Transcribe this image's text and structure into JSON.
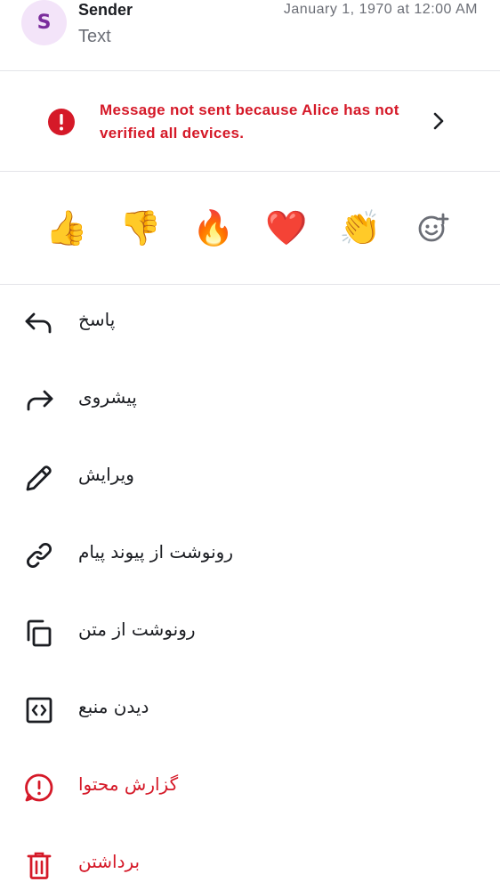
{
  "header": {
    "avatar_letter": "S",
    "sender_name": "Sender",
    "message_preview": "Text",
    "timestamp": "January 1, 1970 at 12:00 AM"
  },
  "banner": {
    "message": "Message not sent because Alice has not verified all devices.",
    "icon": "error-circle-icon",
    "chevron": "chevron-right-icon"
  },
  "reactions": {
    "items": [
      "👍",
      "👎",
      "🔥",
      "❤️",
      "👏"
    ],
    "add_icon": "add-reaction-icon"
  },
  "menu": {
    "reply": "پاسخ",
    "forward": "پیشروی",
    "edit": "ویرایش",
    "copy_link": "رونوشت از پیوند پیام",
    "copy_text": "رونوشت از متن",
    "view_source": "دیدن منبع",
    "report": "گزارش محتوا",
    "remove": "برداشتن"
  },
  "colors": {
    "danger": "#d51928",
    "text": "#1b1d22",
    "secondary": "#6b6e76",
    "avatar_bg": "#f3e4f9",
    "avatar_fg": "#7a2c9c"
  }
}
